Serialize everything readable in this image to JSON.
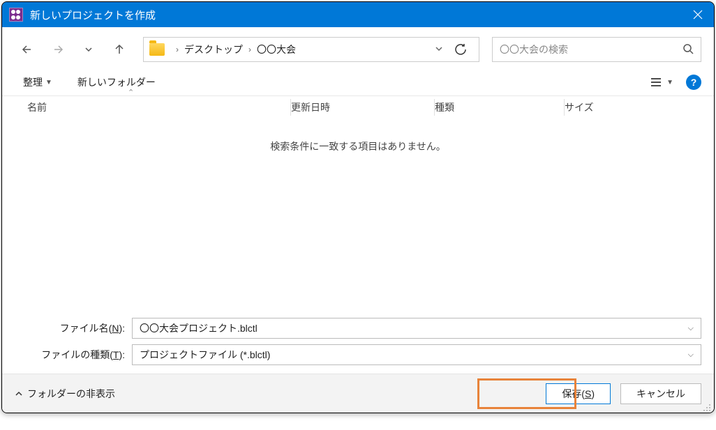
{
  "titlebar": {
    "title": "新しいプロジェクトを作成"
  },
  "breadcrumb": {
    "item1": "デスクトップ",
    "item2": "〇〇大会"
  },
  "search": {
    "placeholder": "〇〇大会の検索"
  },
  "actionbar": {
    "organize": "整理",
    "newfolder": "新しいフォルダー"
  },
  "columns": {
    "name": "名前",
    "date": "更新日時",
    "type": "種類",
    "size": "サイズ"
  },
  "filearea": {
    "empty": "検索条件に一致する項目はありません。"
  },
  "form": {
    "filename_label_prefix": "ファイル名(",
    "filename_label_mnemonic": "N",
    "filename_label_suffix": "):",
    "filename_value": "〇〇大会プロジェクト.blctl",
    "filetype_label_prefix": "ファイルの種類(",
    "filetype_label_mnemonic": "T",
    "filetype_label_suffix": "):",
    "filetype_value": "プロジェクトファイル (*.blctl)"
  },
  "bottom": {
    "hide_folders": "フォルダーの非表示",
    "save_prefix": "保存(",
    "save_mnemonic": "S",
    "save_suffix": ")",
    "cancel": "キャンセル"
  }
}
